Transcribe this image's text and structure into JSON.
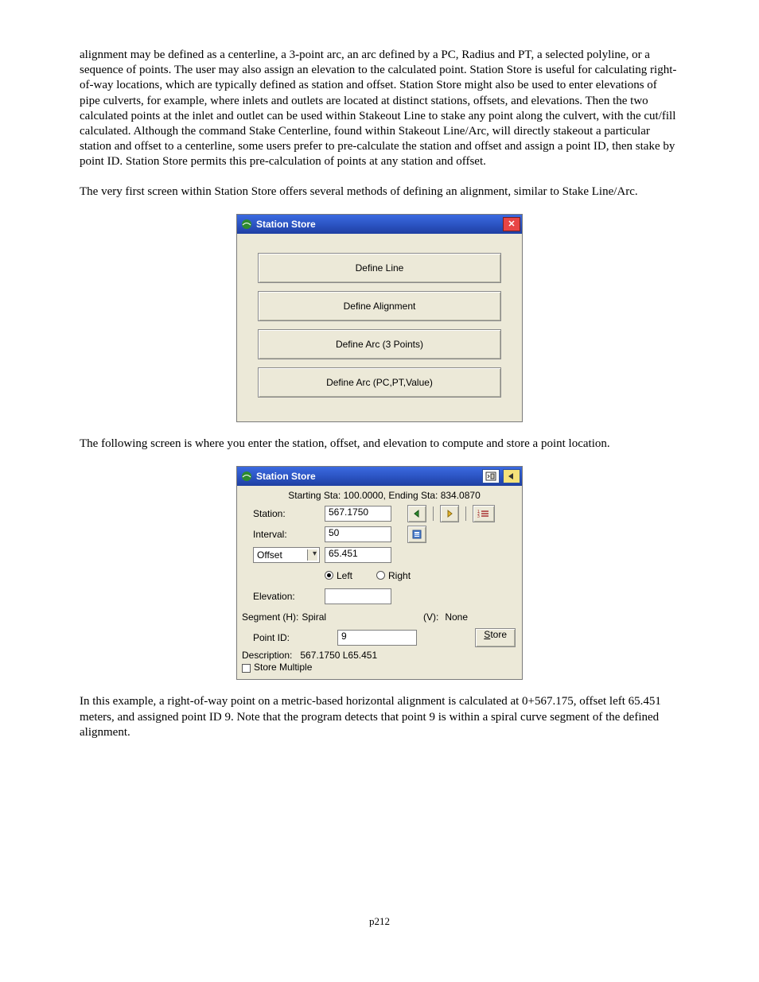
{
  "paragraph1": "alignment may be defined as a centerline, a 3-point arc, an arc defined by a PC, Radius and PT, a selected polyline, or a sequence of points.  The user may also assign an elevation to the calculated point.  Station Store is useful for calculating right-of-way locations, which are typically defined as station and offset.  Station Store might also be used to enter elevations of pipe culverts, for example, where inlets and outlets are located at distinct stations, offsets, and elevations. Then the two calculated points at the inlet and outlet can be used within Stakeout Line to stake any point along the culvert, with the cut/fill calculated.  Although the command Stake Centerline, found within Stakeout Line/Arc, will directly stakeout a particular station and offset to a centerline, some users prefer to pre-calculate the station and offset and assign a point ID, then stake by point ID.  Station Store permits this pre-calculation of points at any station and offset.",
  "paragraph2": "The very first screen within Station Store offers several methods of defining an alignment, similar to Stake Line/Arc.",
  "paragraph3": "The following screen is where you enter the station, offset, and elevation to compute and store a point location.",
  "paragraph4": "In this example, a right-of-way point on a metric-based horizontal alignment is calculated at 0+567.175, offset left 65.451 meters, and assigned point ID 9.  Note that the program detects that point 9 is within a spiral curve segment of the defined alignment.",
  "page_number": "p212",
  "dialog1": {
    "title": "Station Store",
    "buttons": [
      "Define Line",
      "Define Alignment",
      "Define Arc (3 Points)",
      "Define Arc (PC,PT,Value)"
    ]
  },
  "dialog2": {
    "title": "Station Store",
    "starting_line": "Starting Sta: 100.0000, Ending Sta: 834.0870",
    "labels": {
      "station": "Station:",
      "interval": "Interval:",
      "offset": "Offset",
      "left": "Left",
      "right": "Right",
      "elevation": "Elevation:",
      "segment_h_prefix": "Segment (H):",
      "segment_h_value": "Spiral",
      "segment_v_prefix": "(V):",
      "segment_v_value": "None",
      "point_id": "Point ID:",
      "store": "Store",
      "store_first": "S",
      "description_prefix": "Description:",
      "description_value": "567.1750 L65.451",
      "store_multiple": "Store Multiple"
    },
    "values": {
      "station": "567.1750",
      "interval": "50",
      "offset": "65.451",
      "elevation": "",
      "point_id": "9",
      "side_checked": "left"
    }
  }
}
